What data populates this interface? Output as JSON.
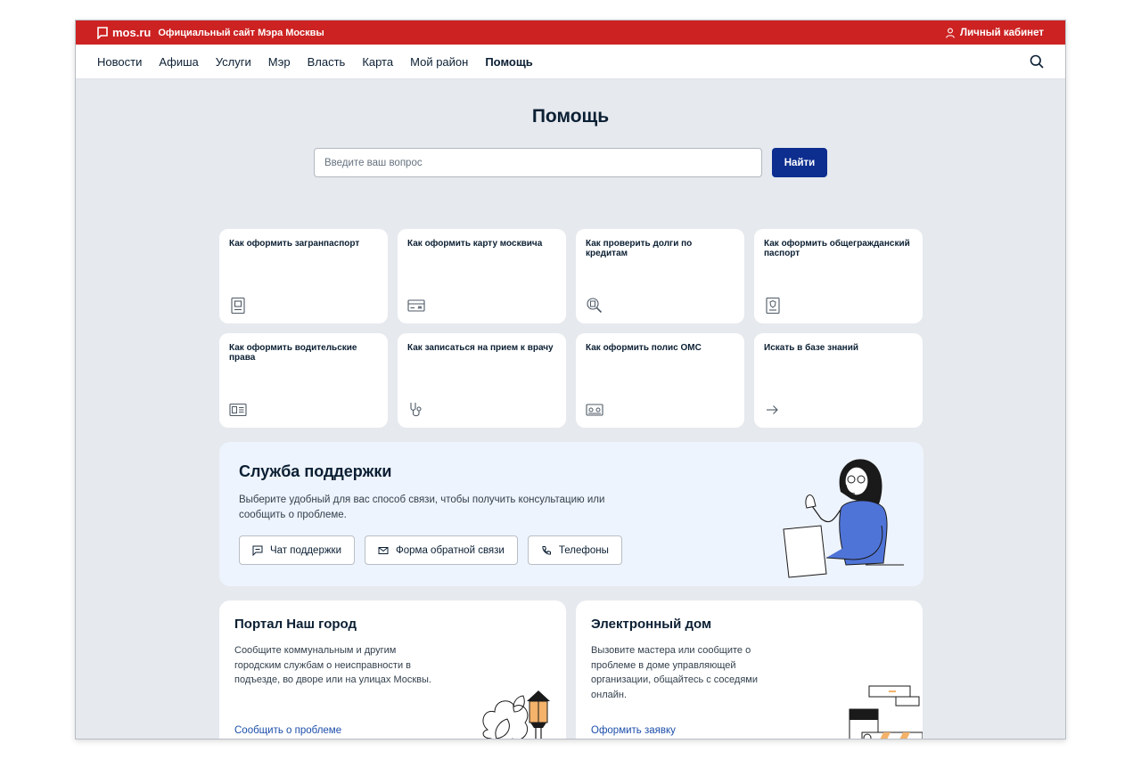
{
  "topbar": {
    "logo_text": "mos.ru",
    "site_description": "Официальный сайт Мэра Москвы",
    "account_label": "Личный кабинет"
  },
  "nav": {
    "items": [
      "Новости",
      "Афиша",
      "Услуги",
      "Мэр",
      "Власть",
      "Карта",
      "Мой район",
      "Помощь"
    ],
    "active": "Помощь"
  },
  "page": {
    "title": "Помощь"
  },
  "search": {
    "placeholder": "Введите ваш вопрос",
    "value": "",
    "button_label": "Найти"
  },
  "cards": [
    {
      "title": "Как оформить загранпаспорт",
      "icon": "passport-icon"
    },
    {
      "title": "Как оформить карту москвича",
      "icon": "card-icon"
    },
    {
      "title": "Как проверить долги по кредитам",
      "icon": "debt-search-icon"
    },
    {
      "title": "Как оформить общегражданский паспорт",
      "icon": "id-passport-icon"
    },
    {
      "title": "Как оформить водительские права",
      "icon": "driver-license-icon"
    },
    {
      "title": "Как записаться на прием к врачу",
      "icon": "stethoscope-icon"
    },
    {
      "title": "Как оформить полис ОМС",
      "icon": "insurance-policy-icon"
    },
    {
      "title": "Искать в базе знаний",
      "icon": "arrow-right-icon"
    }
  ],
  "support": {
    "title": "Служба поддержки",
    "description": "Выберите удобный для вас способ связи, чтобы получить консультацию или сообщить о проблеме.",
    "buttons": [
      {
        "label": "Чат поддержки",
        "icon": "chat-icon"
      },
      {
        "label": "Форма обратной связи",
        "icon": "mail-icon"
      },
      {
        "label": "Телефоны",
        "icon": "phone-icon"
      }
    ]
  },
  "portal": {
    "title": "Портал Наш город",
    "description": "Сообщите коммунальным и другим городским службам о неисправности в подъезде, во дворе или на улицах Москвы.",
    "link": "Сообщить о проблеме"
  },
  "edom": {
    "title": "Электронный дом",
    "description": "Вызовите мастера или сообщите о проблеме в доме управляющей организации, общайтесь с соседями онлайн.",
    "link": "Оформить заявку"
  },
  "colors": {
    "brand_red": "#cc2222",
    "primary_blue": "#0d2d8f",
    "link_blue": "#1c4eaa",
    "page_bg": "#e6e9ee",
    "support_bg": "#eef4fd"
  }
}
